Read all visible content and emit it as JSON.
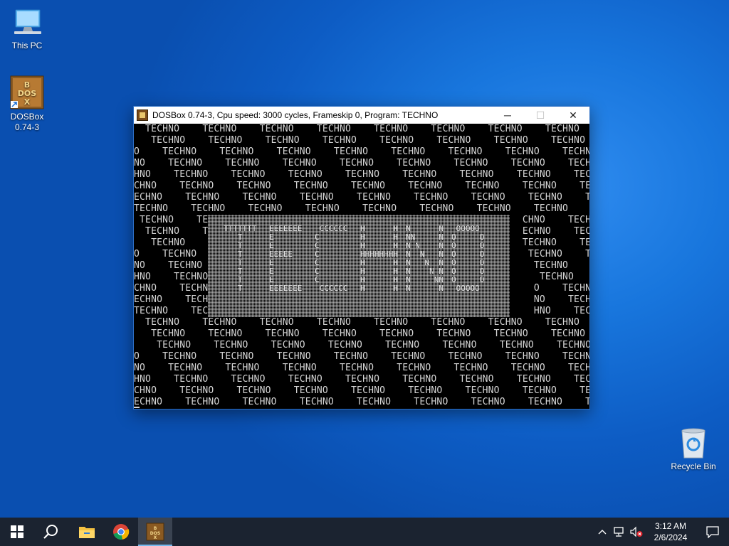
{
  "desktop": {
    "icons": [
      {
        "label": "This PC",
        "icon": "computer-icon"
      },
      {
        "label": "DOSBox\n0.74-3",
        "line1": "DOSBox",
        "line2": "0.74-3",
        "icon": "dosbox-icon"
      },
      {
        "label": "Recycle Bin",
        "icon": "recycle-bin-icon"
      }
    ]
  },
  "window": {
    "title": "DOSBox 0.74-3, Cpu speed:     3000 cycles, Frameskip  0, Program:   TECHNO",
    "buttons": {
      "minimize": "─",
      "maximize": "☐",
      "close": "✕"
    },
    "screen": {
      "rows": [
        "  TECHNO    TECHNO    TECHNO    TECHNO    TECHNO    TECHNO    TECHNO    TECHNO    TECHNO",
        "   TECHNO    TECHNO    TECHNO    TECHNO    TECHNO    TECHNO    TECHNO    TECHNO    TECHN",
        "O    TECHNO    TECHNO    TECHNO    TECHNO    TECHNO    TECHNO    TECHNO    TECHNO    TECH",
        "NO    TECHNO    TECHNO    TECHNO    TECHNO    TECHNO    TECHNO    TECHNO    TECHNO    TEC",
        "HNO    TECHNO    TECHNO    TECHNO    TECHNO    TECHNO    TECHNO    TECHNO    TECHNO    TE",
        "CHNO    TECHNO    TECHNO    TECHNO    TECHNO    TECHNO    TECHNO    TECHNO    TECHNO    T",
        "ECHNO    TECHNO    TECHNO    TECHNO    TECHNO    TECHNO    TECHNO    TECHNO    TECHNO",
        "TECHNO    TECHNO    TECHNO    TECHNO    TECHNO    TECHNO    TECHNO    TECHNO    TECHNO",
        " TECHNO    TEC                                                      CHNO    TECHNO",
        "  TECHNO    TE                                                      ECHNO    TECHNO",
        "   TECHNO                                                           TECHNO    TECHN",
        "O    TECHNO                                                          TECHNO    TECH",
        "NO    TECHNO                                                          TECHNO    TEC",
        "HNO    TECHNO                                                          TECHNO    TE",
        "CHNO    TECHNO                                                        O    TECHNO    T",
        "ECHNO    TECHN                                                        NO    TECHNO",
        "TECHNO    TECH                                                        HNO    TECHNO",
        "  TECHNO    TECHNO    TECHNO    TECHNO    TECHNO    TECHNO    TECHNO    TECHNO    TECHNO",
        "   TECHNO    TECHNO    TECHNO    TECHNO    TECHNO    TECHNO    TECHNO    TECHNO    TECHNO",
        "    TECHNO    TECHNO    TECHNO    TECHNO    TECHNO    TECHNO    TECHNO    TECHNO    TECHN",
        "O    TECHNO    TECHNO    TECHNO    TECHNO    TECHNO    TECHNO    TECHNO    TECHNO    TECH",
        "NO    TECHNO    TECHNO    TECHNO    TECHNO    TECHNO    TECHNO    TECHNO    TECHNO    TEC",
        "HNO    TECHNO    TECHNO    TECHNO    TECHNO    TECHNO    TECHNO    TECHNO    TECHNO    TE",
        "CHNO    TECHNO    TECHNO    TECHNO    TECHNO    TECHNO    TECHNO    TECHNO    TECHNO    T",
        "ECHNO    TECHNO    TECHNO    TECHNO    TECHNO    TECHNO    TECHNO    TECHNO    TECHNO"
      ],
      "logo": {
        "t": "TTTTTTT\n   T\n   T\n   T\n   T\n   T\n   T\n   T",
        "e": "EEEEEEE\nE\nE\nEEEEE\nE\nE\nE\nEEEEEEE",
        "c": " CCCCCC\nC\nC\nC\nC\nC\nC\n CCCCCC",
        "h": "H      H\nH      H\nH      H\nHHHHHHHH\nH      H\nH      H\nH      H\nH      H",
        "n": "N      N\nNN     N\nN N    N\nN  N   N\nN   N  N\nN    N N\nN     NN\nN      N",
        "o": " OOOOO\nO     O\nO     O\nO     O\nO     O\nO     O\nO     O\n OOOOO"
      }
    }
  },
  "taskbar": {
    "start": "windows-start-icon",
    "search": "search-icon",
    "apps": [
      {
        "name": "file-explorer",
        "icon": "folder-icon"
      },
      {
        "name": "chrome",
        "icon": "chrome-icon"
      },
      {
        "name": "dosbox",
        "icon": "dosbox-icon",
        "active": true
      }
    ],
    "tray": {
      "time": "3:12 AM",
      "date": "2/6/2024"
    }
  },
  "colors": {
    "desktop_blue": "#0d5cc4",
    "taskbar": "#1b2330",
    "dos_text": "#d6d6d6"
  }
}
